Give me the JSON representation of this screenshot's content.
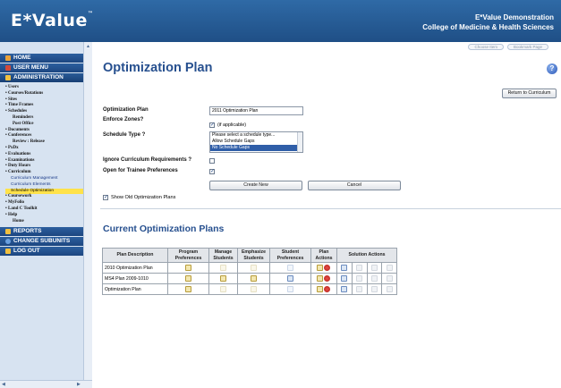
{
  "header": {
    "logo": "E*Value",
    "logo_tm": "™",
    "org_line1": "E*Value Demonstration",
    "org_line2": "College of Medicine & Health Sciences"
  },
  "top_buttons": [
    "Choose Item",
    "Bookmark Page"
  ],
  "sidebar": {
    "home": "HOME",
    "user_menu": "USER MENU",
    "administration": "ADMINISTRATION",
    "items": [
      {
        "label": "• Users",
        "level": "item"
      },
      {
        "label": "• Courses/Rotations",
        "level": "item"
      },
      {
        "label": "• Sites",
        "level": "item"
      },
      {
        "label": "• Time Frames",
        "level": "item"
      },
      {
        "label": "• Schedules",
        "level": "item"
      },
      {
        "label": "Reminders",
        "level": "sub"
      },
      {
        "label": "Post Office",
        "level": "sub"
      },
      {
        "label": "• Documents",
        "level": "item"
      },
      {
        "label": "• Conferences",
        "level": "item"
      },
      {
        "label": "Review : Release",
        "level": "sub"
      },
      {
        "label": "• PxDx",
        "level": "item"
      },
      {
        "label": "• Evaluations",
        "level": "item"
      },
      {
        "label": "• Examinations",
        "level": "item"
      },
      {
        "label": "• Duty Hours",
        "level": "item"
      },
      {
        "label": "• Curriculum",
        "level": "item"
      },
      {
        "label": "Curriculum Management",
        "level": "sub2"
      },
      {
        "label": "Curriculum Elements",
        "level": "sub2"
      },
      {
        "label": "Schedule Optimization",
        "level": "sub2",
        "highlight": true
      },
      {
        "label": "• Coursework",
        "level": "item"
      },
      {
        "label": "• MyFolio",
        "level": "item"
      },
      {
        "label": "• Land C Toolkit",
        "level": "item"
      },
      {
        "label": "• Help",
        "level": "item"
      },
      {
        "label": "Home",
        "level": "sub"
      }
    ],
    "reports": "REPORTS",
    "change_subunits": "CHANGE SUBUNITS",
    "log_out": "LOG OUT"
  },
  "page": {
    "title": "Optimization Plan",
    "return_button": "Return to Curriculum"
  },
  "form": {
    "plan_label": "Optimization Plan",
    "plan_value": "2011 Optimization Plan",
    "enforce_label": "Enforce Zones?",
    "enforce_note": "(if applicable)",
    "schedule_type_label": "Schedule Type ?",
    "schedule_type_options": [
      "Please select a schedule type...",
      "Allow Schedule Gaps",
      "No Schedule Gaps"
    ],
    "schedule_type_selected": "No Schedule Gaps",
    "ignore_label": "Ignore Curriculum Requirements ?",
    "open_label": "Open for Trainee Preferences",
    "create_button": "Create New",
    "cancel_button": "Cancel",
    "show_old": "Show Old Optimization Plans"
  },
  "plans": {
    "title": "Current Optimization Plans",
    "headers": {
      "plan": "Plan Description",
      "program": "Program Preferences",
      "manage": "Manage Students",
      "emphasize": "Emphasize Students",
      "student": "Student Preferences",
      "actions": "Plan Actions",
      "solution": "Solution Actions"
    },
    "rows": [
      {
        "name": "2010 Optimization Plan"
      },
      {
        "name": "MS4 Plan 2009-1010"
      },
      {
        "name": "Optimization Plan"
      }
    ]
  },
  "colors": {
    "header": "#1f4f86",
    "title": "#27508f",
    "sidebar_bg": "#d7e3f1",
    "highlight": "#ffe24a"
  }
}
